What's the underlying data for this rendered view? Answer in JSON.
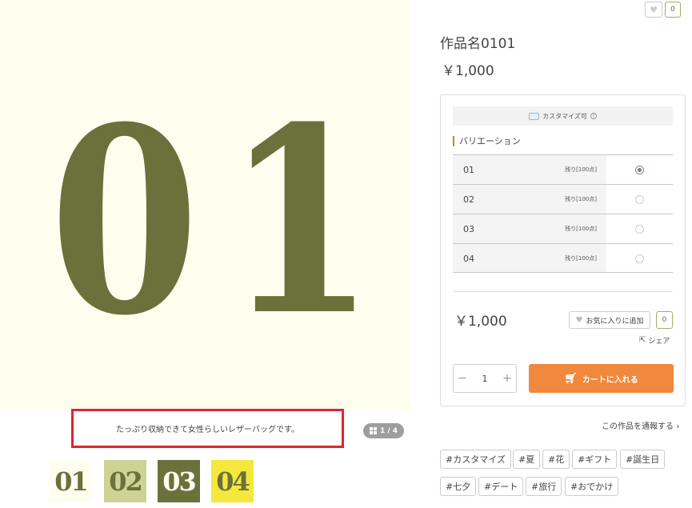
{
  "main_image": {
    "digits": [
      "0",
      "1"
    ]
  },
  "caption": "たっぷり収納できて女性らしいレザーバッグです。",
  "counter": "1 / 4",
  "thumbnails": [
    "01",
    "02",
    "03",
    "04"
  ],
  "fav_top": {
    "icon": "heart-icon",
    "count": "0"
  },
  "product": {
    "title": "作品名0101",
    "price": "￥1,000"
  },
  "customize": {
    "label": "カスタマイズ可",
    "info": "?"
  },
  "variation": {
    "label": "バリエーション",
    "options": [
      {
        "name": "01",
        "stock": "残り[100点]",
        "selected": true
      },
      {
        "name": "02",
        "stock": "残り[100点]",
        "selected": false
      },
      {
        "name": "03",
        "stock": "残り[100点]",
        "selected": false
      },
      {
        "name": "04",
        "stock": "残り[100点]",
        "selected": false
      }
    ]
  },
  "purchase": {
    "price": "￥1,000",
    "fav_label": "お気に入りに追加",
    "fav_count": "0",
    "share_label": "シェア",
    "qty_minus": "−",
    "qty_value": "1",
    "qty_plus": "+",
    "cart_label": "カートに入れる"
  },
  "report": "この作品を通報する",
  "tags": [
    "#カスタマイズ",
    "#夏",
    "#花",
    "#ギフト",
    "#誕生日",
    "#七夕",
    "#デート",
    "#旅行",
    "#おでかけ"
  ]
}
